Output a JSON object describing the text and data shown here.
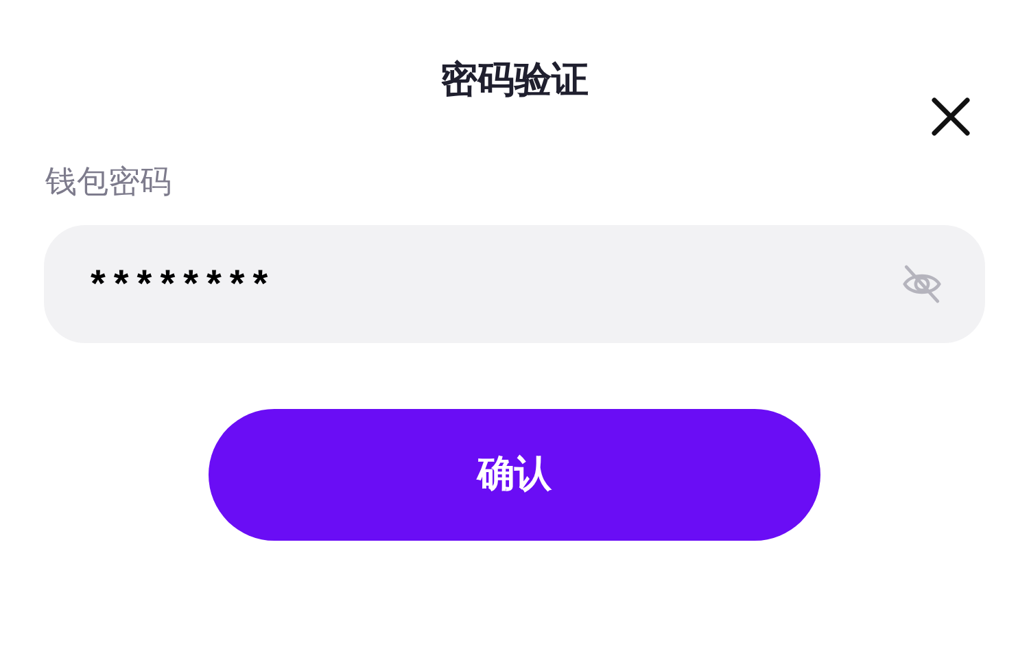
{
  "dialog": {
    "title": "密码验证"
  },
  "password": {
    "label": "钱包密码",
    "value": "********",
    "visible": false
  },
  "confirm_button": {
    "label": "确认"
  }
}
